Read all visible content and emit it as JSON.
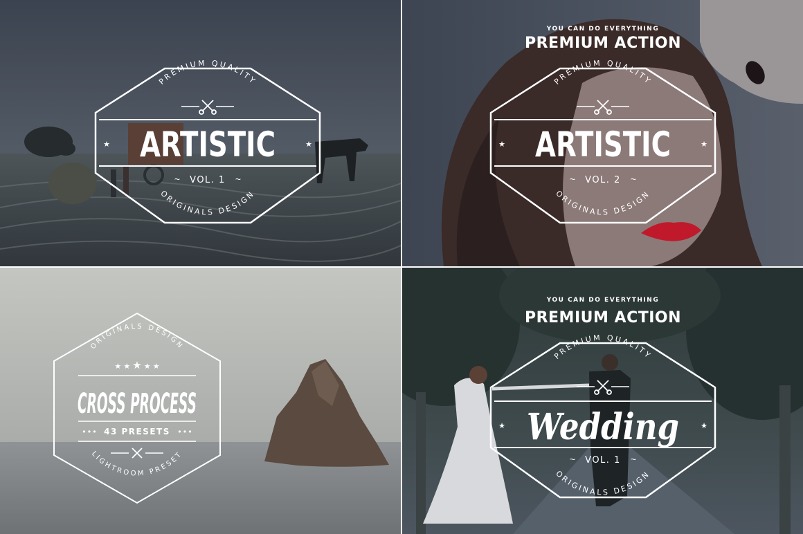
{
  "panels": [
    {
      "arc_top": "PREMIUM QUALITY",
      "title": "ARTISTIC",
      "volume": "VOL. 1",
      "arc_bottom": "ORIGINALS DESIGN"
    },
    {
      "kicker": "YOU CAN DO EVERYTHING",
      "heading": "PREMIUM ACTION",
      "arc_top": "PREMIUM QUALITY",
      "title": "ARTISTIC",
      "volume": "VOL. 2",
      "arc_bottom": "ORIGINALS DESIGN"
    },
    {
      "arc_top": "ORIGINALS DESIGN",
      "title": "CROSS PROCESS",
      "presets": "43 PRESETS",
      "arc_bottom": "LIGHTROOM PRESET"
    },
    {
      "kicker": "YOU CAN DO EVERYTHING",
      "heading": "PREMIUM ACTION",
      "arc_top": "PREMIUM QUALITY",
      "title": "Wedding",
      "volume": "VOL. 1",
      "arc_bottom": "ORIGINALS DESIGN"
    }
  ],
  "icons": [
    "scissors-icon",
    "star-icon",
    "tilde-ornament-icon"
  ],
  "colors": {
    "overlay_slate": "#3e4654",
    "sea_gray": "#8d9194",
    "rock_brown": "#5b4a40",
    "lips_red": "#c0192b",
    "badge_line": "#ffffff"
  }
}
